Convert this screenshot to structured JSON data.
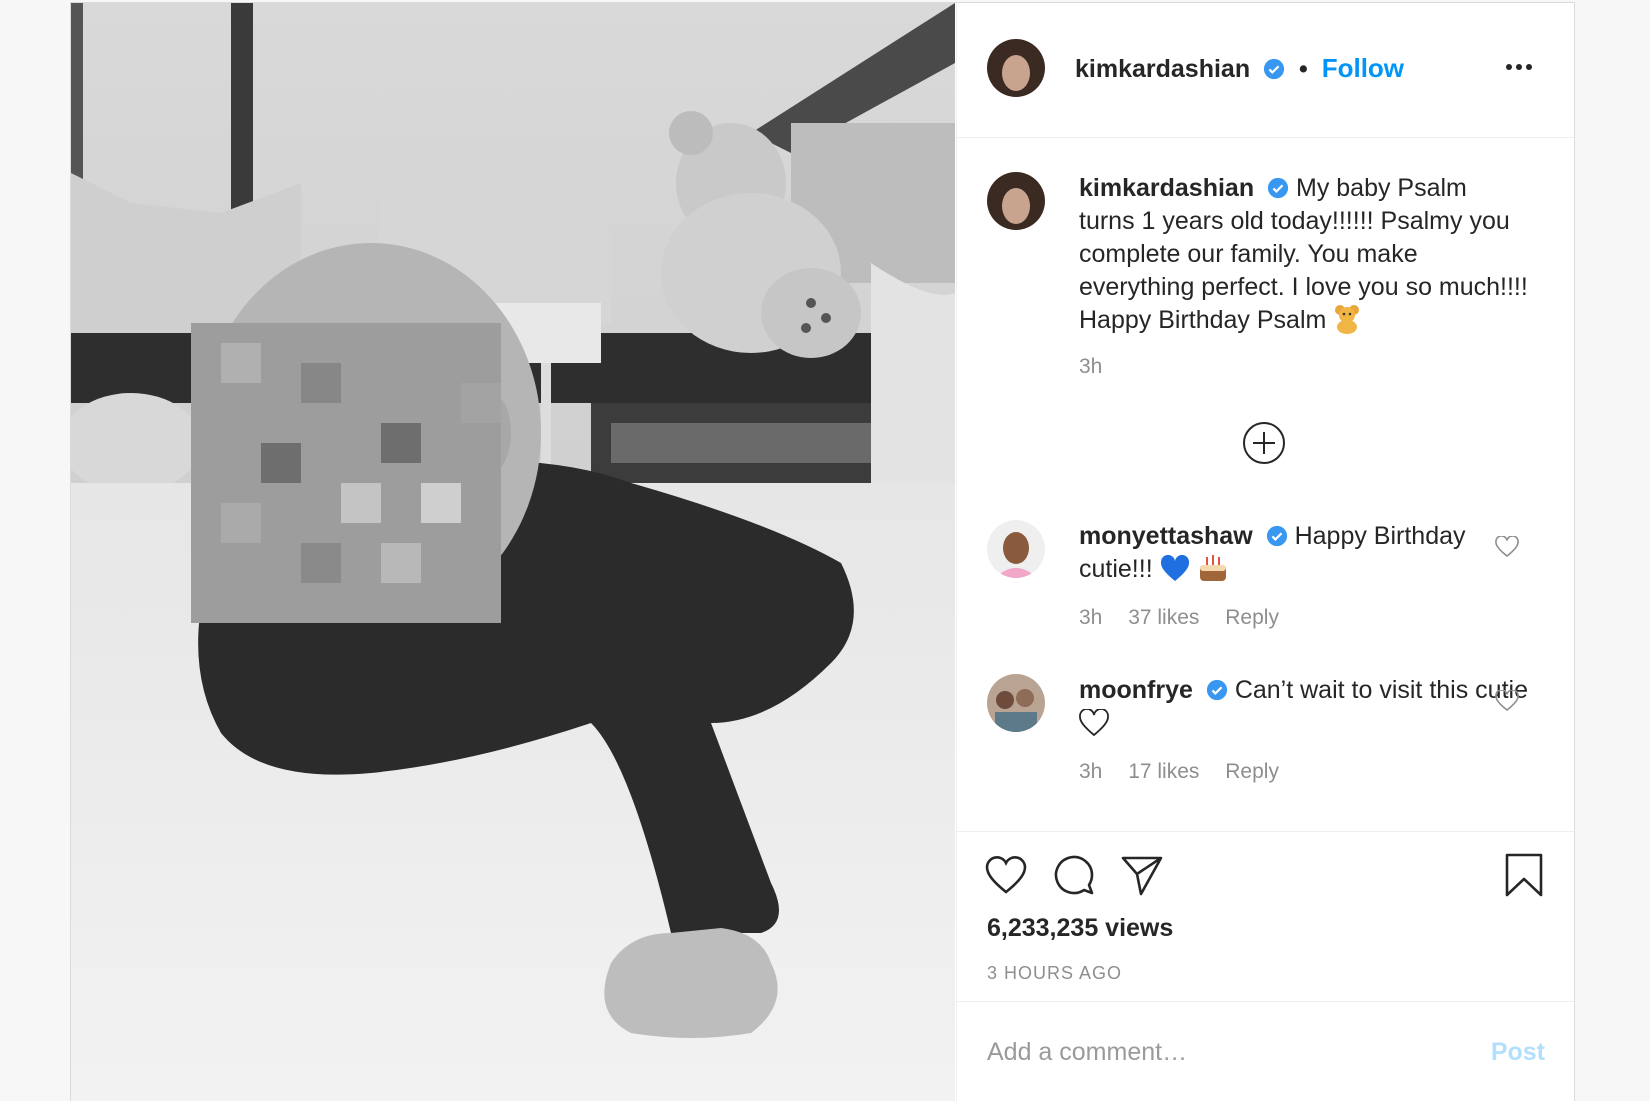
{
  "post": {
    "username": "kimkardashian",
    "follow_label": "Follow",
    "dot": "•",
    "more_icon": "more-options-icon"
  },
  "caption": {
    "username": "kimkardashian",
    "text": "My baby Psalm turns 1 years old today!!!!!! Psalmy you complete our family. You make everything perfect. I love you so much!!!! Happy Birthday Psalm",
    "emoji": "teddy-bear",
    "time": "3h"
  },
  "comments": [
    {
      "username": "monyettashaw",
      "text": "Happy Birthday cutie!!!",
      "emoji": "blue-heart + cake",
      "time": "3h",
      "likes": "37 likes",
      "reply": "Reply"
    },
    {
      "username": "moonfrye",
      "text": "Can’t wait to visit this cutie",
      "emoji": "white-heart",
      "time": "3h",
      "likes": "17 likes",
      "reply": "Reply"
    }
  ],
  "footer": {
    "views": "6,233,235 views",
    "time_ago": "3 HOURS AGO",
    "comment_placeholder": "Add a comment…",
    "post_label": "Post"
  },
  "colors": {
    "accent": "#0095f6",
    "verified": "#3897f0",
    "muted": "#8e8e8e",
    "post_disabled": "#b2dffc"
  }
}
